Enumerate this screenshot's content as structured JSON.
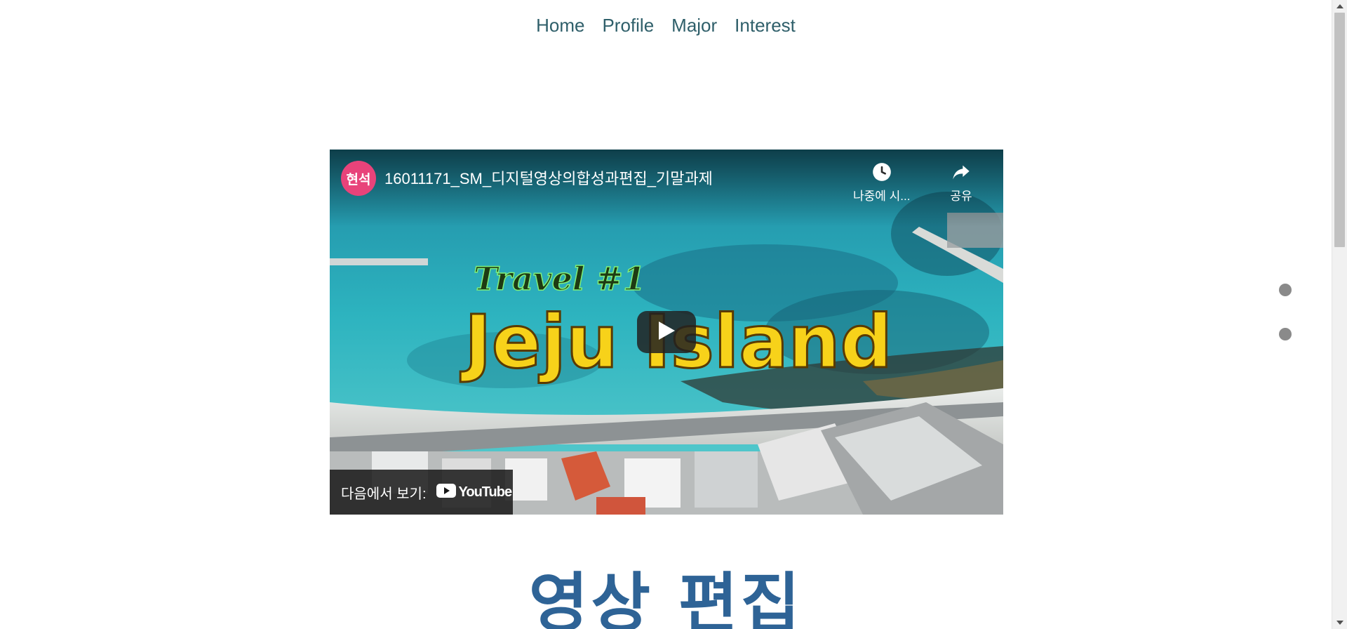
{
  "nav": {
    "items": [
      "Home",
      "Profile",
      "Major",
      "Interest"
    ]
  },
  "video": {
    "channel_avatar_text": "현석",
    "title": "16011171_SM_디지털영상의합성과편집_기말과제",
    "watch_later_label": "나중에 시...",
    "share_label": "공유",
    "watch_on_label": "다음에서 보기:",
    "youtube_word": "YouTube",
    "overlay_line1": "Travel #1",
    "overlay_line2": "Jeju Island",
    "colors": {
      "avatar": "#e8437a",
      "overlay_text": "#f7d21a"
    }
  },
  "section": {
    "heading": "영상 편집"
  },
  "side_dots": {
    "count": 2
  },
  "icons": {
    "watch_later": "clock-icon",
    "share": "share-arrow-icon",
    "play": "play-icon",
    "youtube": "youtube-logo-icon"
  },
  "colors": {
    "nav_text": "#2f5f6a",
    "heading": "#2e6396",
    "dots": "#8a8a8a"
  }
}
